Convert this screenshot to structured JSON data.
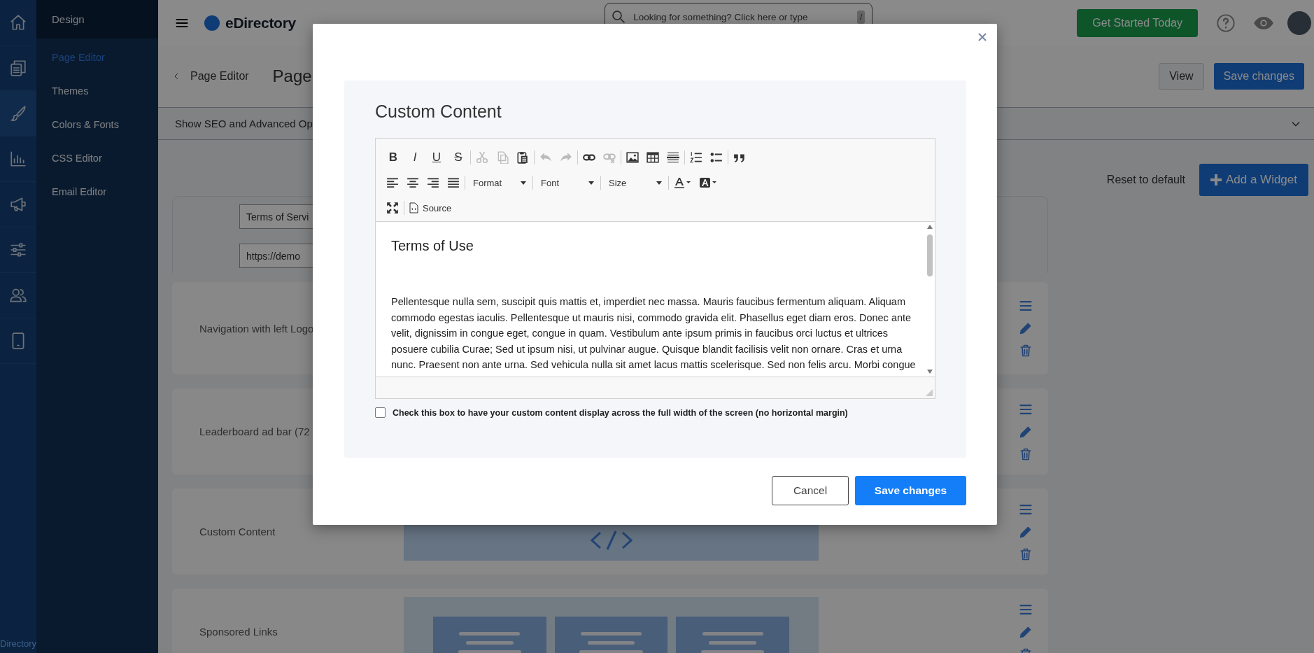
{
  "rail": {
    "items": [
      {
        "kind": "home",
        "selected": false
      },
      {
        "kind": "pages",
        "selected": false
      },
      {
        "kind": "brush",
        "selected": true
      },
      {
        "kind": "chart",
        "selected": false
      },
      {
        "kind": "megaphone",
        "selected": false
      },
      {
        "kind": "sliders",
        "selected": false
      },
      {
        "kind": "users",
        "selected": false
      },
      {
        "kind": "tablet",
        "selected": false
      }
    ],
    "footer": "Directory"
  },
  "sidebar": {
    "title": "Design",
    "items": [
      {
        "label": "Page Editor",
        "selected": true
      },
      {
        "label": "Themes",
        "selected": false
      },
      {
        "label": "Colors & Fonts",
        "selected": false
      },
      {
        "label": "CSS Editor",
        "selected": false
      },
      {
        "label": "Email Editor",
        "selected": false
      }
    ]
  },
  "topbar": {
    "logo": "eDirectory",
    "search": {
      "placeholder": "Looking for something? Click here or type",
      "key": "/"
    },
    "cta": "Get Started Today"
  },
  "header": {
    "back": "Page Editor",
    "title": "Page",
    "buttons": [
      {
        "label": "View",
        "kind": "secondary"
      },
      {
        "label": "Save changes",
        "kind": "primary"
      }
    ]
  },
  "seo": {
    "label": "Show SEO and Advanced Op"
  },
  "actions": {
    "reset": "Reset to default",
    "add": "Add a Widget"
  },
  "page_fields": [
    {
      "value": "Terms of Servi"
    },
    {
      "value": "https://demo"
    }
  ],
  "widgets": [
    {
      "label": "Navigation with left Logo",
      "kind": "plain"
    },
    {
      "label": "Leaderboard ad bar (72",
      "kind": "plain"
    },
    {
      "label": "Custom Content",
      "kind": "code"
    },
    {
      "label": "Sponsored Links",
      "kind": "cards"
    }
  ],
  "modal": {
    "title": "Custom Content",
    "toolbar": [
      [
        [
          {
            "kind": "bold",
            "label": "B",
            "disabled": false
          },
          {
            "kind": "italic",
            "label": "I",
            "disabled": false
          },
          {
            "kind": "underline",
            "label": "U",
            "disabled": false
          },
          {
            "kind": "strike",
            "label": "S",
            "disabled": false
          }
        ],
        [
          {
            "kind": "cut",
            "disabled": true
          },
          {
            "kind": "copy",
            "disabled": true
          },
          {
            "kind": "paste",
            "disabled": false
          }
        ],
        [
          {
            "kind": "undo",
            "disabled": true
          },
          {
            "kind": "redo",
            "disabled": true
          }
        ],
        [
          {
            "kind": "link",
            "disabled": false
          },
          {
            "kind": "unlink",
            "disabled": true
          }
        ],
        [
          {
            "kind": "image",
            "disabled": false
          },
          {
            "kind": "table",
            "disabled": false
          },
          {
            "kind": "hrule",
            "disabled": false
          }
        ],
        [
          {
            "kind": "numbered",
            "disabled": false
          },
          {
            "kind": "bulleted",
            "disabled": false
          }
        ],
        [
          {
            "kind": "quote",
            "disabled": false
          }
        ]
      ],
      [
        [
          {
            "kind": "align-left",
            "disabled": false
          },
          {
            "kind": "align-center",
            "disabled": false
          },
          {
            "kind": "align-right",
            "disabled": false
          },
          {
            "kind": "justify",
            "disabled": false
          }
        ],
        [
          {
            "kind": "dropdown",
            "label": "Format",
            "disabled": false
          }
        ],
        [
          {
            "kind": "dropdown",
            "label": "Font",
            "disabled": false
          }
        ],
        [
          {
            "kind": "dropdown",
            "label": "Size",
            "disabled": false
          }
        ],
        [
          {
            "kind": "text-color",
            "disabled": false
          },
          {
            "kind": "bg-color",
            "disabled": false
          }
        ]
      ],
      [
        [
          {
            "kind": "maximize",
            "disabled": false
          }
        ],
        [
          {
            "kind": "source",
            "label": "Source",
            "disabled": false
          }
        ]
      ]
    ],
    "content": {
      "heading": "Terms of Use",
      "paragraph": "Pellentesque nulla sem, suscipit quis mattis et, imperdiet nec massa. Mauris faucibus fermentum aliquam. Aliquam commodo egestas iaculis. Pellentesque ut mauris nisi, commodo gravida elit. Phasellus eget diam eros. Donec ante velit, dignissim in congue eget, congue in quam. Vestibulum ante ipsum primis in faucibus orci luctus et ultrices posuere cubilia Curae; Sed ut ipsum nisi, ut pulvinar augue. Quisque blandit facilisis velit non ornare. Cras et urna nunc. Praesent non ante urna. Sed vehicula nulla sit amet lacus mattis scelerisque. Sed non felis arcu. Morbi congue"
    },
    "checkbox": {
      "label": "Check this box to have your custom content display across the full width of the screen (no horizontal margin)",
      "checked": false
    },
    "buttons": [
      {
        "label": "Cancel",
        "kind": "secondary"
      },
      {
        "label": "Save changes",
        "kind": "primary"
      }
    ]
  }
}
